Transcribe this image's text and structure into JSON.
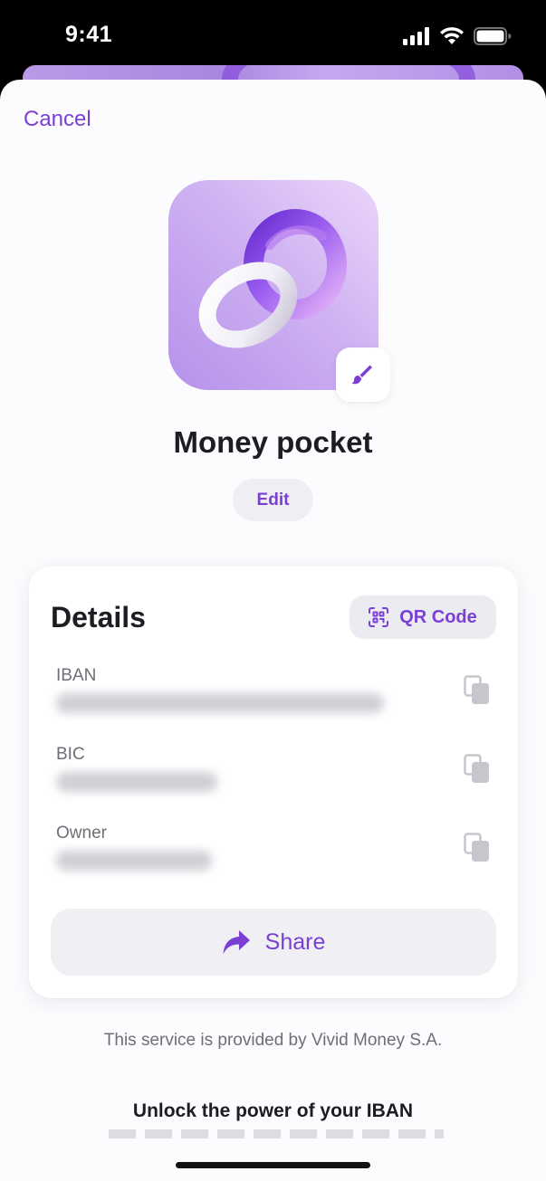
{
  "status_bar": {
    "time": "9:41"
  },
  "header": {
    "cancel_label": "Cancel"
  },
  "pocket": {
    "name": "Money pocket",
    "edit_label": "Edit"
  },
  "details": {
    "title": "Details",
    "qr_label": "QR Code",
    "fields": [
      {
        "label": "IBAN"
      },
      {
        "label": "BIC"
      },
      {
        "label": "Owner"
      }
    ],
    "share_label": "Share"
  },
  "footer": {
    "provider_text": "This service is provided by Vivid Money S.A.",
    "unlock_title": "Unlock the power of your IBAN"
  },
  "colors": {
    "accent": "#7b3fd6",
    "background": "#fcfcfe"
  }
}
